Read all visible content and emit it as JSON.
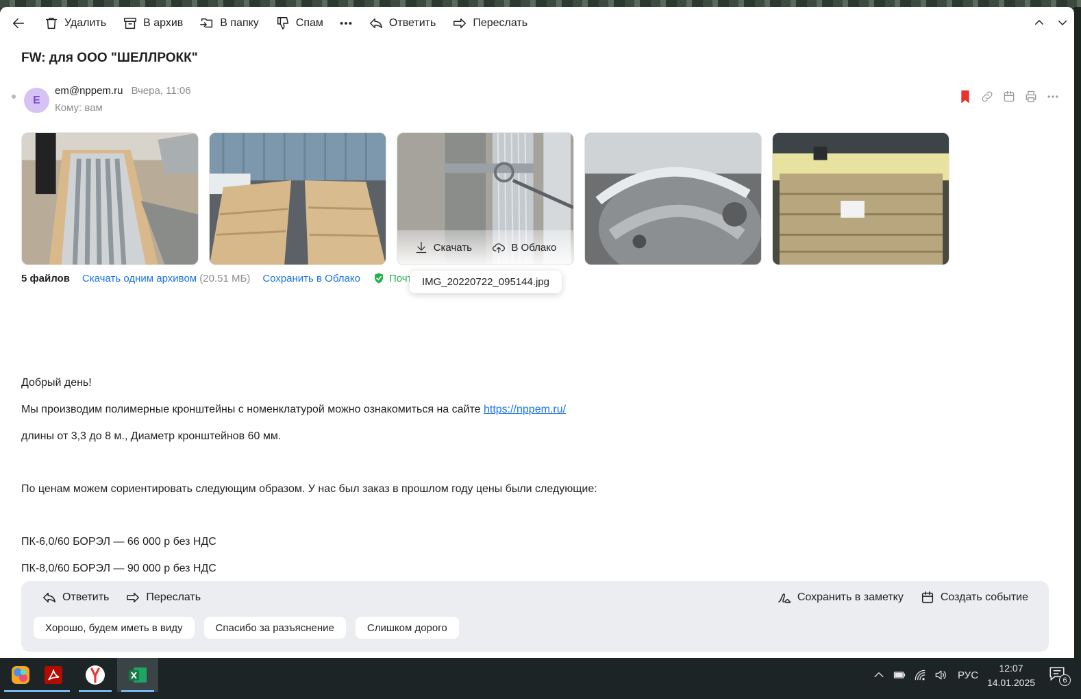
{
  "toolbar": {
    "delete": "Удалить",
    "archive": "В архив",
    "to_folder": "В папку",
    "spam": "Спам",
    "reply": "Ответить",
    "forward": "Переслать"
  },
  "email": {
    "subject": "FW: для ООО \"ШЕЛЛРОКК\"",
    "avatar_letter": "E",
    "sender": "em@nppem.ru",
    "date": "Вчера, 11:06",
    "recipient": "Кому: вам"
  },
  "attachments": {
    "hover_download": "Скачать",
    "hover_cloud": "В Облако",
    "tooltip_filename": "IMG_20220722_095144.jpg",
    "count_label": "5 файлов",
    "download_archive": "Скачать одним архивом",
    "archive_size": "(20.51 МБ)",
    "save_cloud": "Сохранить в Облако",
    "mail_check": "Почта"
  },
  "body": {
    "greeting": "Добрый день!",
    "line1": "Мы производим полимерные кронштейны с номенклатурой можно ознакомиться на сайте",
    "line1_link": "https://nppem.ru/",
    "line2": "длины от 3,3 до 8 м., Диаметр кронштейнов 60 мм.",
    "line3": "По ценам можем сориентировать следующим образом. У нас был заказ в прошлом году цены были следующие:",
    "line4": "ПК-6,0/60 БОРЭЛ — 66 000 р без НДС",
    "line5": "ПК-8,0/60 БОРЭЛ — 90 000 р без НДС"
  },
  "reply_panel": {
    "reply": "Ответить",
    "forward": "Переслать",
    "save_note": "Сохранить в заметку",
    "create_event": "Создать событие",
    "quick_replies": [
      "Хорошо, будем иметь в виду",
      "Спасибо за разъяснение",
      "Слишком дорого"
    ]
  },
  "taskbar": {
    "language": "РУС",
    "time": "12:07",
    "date": "14.01.2025",
    "notifications": "6"
  }
}
